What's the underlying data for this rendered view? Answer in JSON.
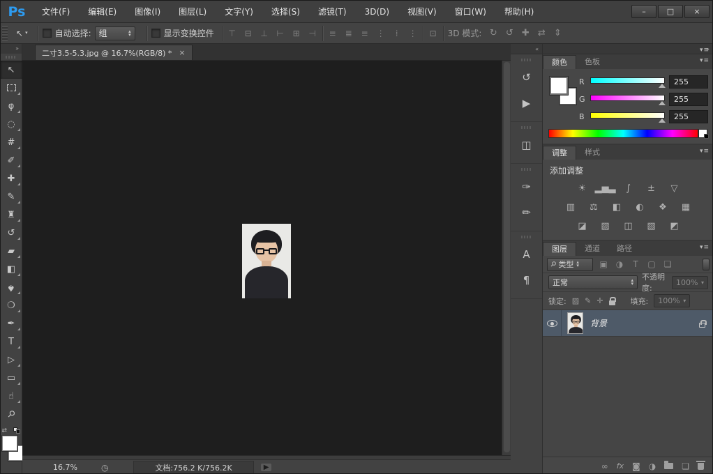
{
  "titlebar": {
    "logo": "Ps",
    "menus": [
      {
        "name": "menu-file",
        "label": "文件(F)"
      },
      {
        "name": "menu-edit",
        "label": "编辑(E)"
      },
      {
        "name": "menu-image",
        "label": "图像(I)"
      },
      {
        "name": "menu-layer",
        "label": "图层(L)"
      },
      {
        "name": "menu-type",
        "label": "文字(Y)"
      },
      {
        "name": "menu-select",
        "label": "选择(S)"
      },
      {
        "name": "menu-filter",
        "label": "滤镜(T)"
      },
      {
        "name": "menu-3d",
        "label": "3D(D)"
      },
      {
        "name": "menu-view",
        "label": "视图(V)"
      },
      {
        "name": "menu-window",
        "label": "窗口(W)"
      },
      {
        "name": "menu-help",
        "label": "帮助(H)"
      }
    ],
    "window_controls": {
      "minimize": "–",
      "maximize": "□",
      "close": "×"
    }
  },
  "options_bar": {
    "tool_glyph": "↖",
    "auto_select_label": "自动选择:",
    "auto_select_value": "组",
    "show_transform_label": "显示变换控件",
    "align_icons": [
      {
        "name": "align-top-edges-icon",
        "glyph": "⊤"
      },
      {
        "name": "align-vertical-centers-icon",
        "glyph": "⊟"
      },
      {
        "name": "align-bottom-edges-icon",
        "glyph": "⊥"
      },
      {
        "name": "align-left-edges-icon",
        "glyph": "⊢"
      },
      {
        "name": "align-horizontal-centers-icon",
        "glyph": "⊞"
      },
      {
        "name": "align-right-edges-icon",
        "glyph": "⊣"
      }
    ],
    "distribute_icons": [
      {
        "name": "distribute-top-edges-icon",
        "glyph": "≡"
      },
      {
        "name": "distribute-vertical-centers-icon",
        "glyph": "≣"
      },
      {
        "name": "distribute-bottom-edges-icon",
        "glyph": "≡"
      },
      {
        "name": "distribute-left-edges-icon",
        "glyph": "⋮"
      },
      {
        "name": "distribute-horizontal-centers-icon",
        "glyph": "⁞"
      },
      {
        "name": "distribute-right-edges-icon",
        "glyph": "⋮"
      }
    ],
    "auto_align": {
      "name": "auto-align-layers-icon",
      "glyph": "⊡"
    },
    "threed_label": "3D 模式:",
    "threed_icons": [
      {
        "name": "3d-rotate-icon",
        "glyph": "↻"
      },
      {
        "name": "3d-roll-icon",
        "glyph": "↺"
      },
      {
        "name": "3d-drag-icon",
        "glyph": "✚"
      },
      {
        "name": "3d-slide-icon",
        "glyph": "⇄"
      },
      {
        "name": "3d-scale-icon",
        "glyph": "⇕"
      }
    ]
  },
  "document_tab": {
    "title": "二寸3.5-5.3.jpg @ 16.7%(RGB/8) *",
    "close": "×"
  },
  "toolbar": {
    "collapse": "»",
    "tools": [
      {
        "name": "move-tool",
        "glyph": "↖",
        "cls": "selected"
      },
      {
        "name": "rectangular-marquee-tool",
        "glyph": "",
        "cls": "flyout marquee"
      },
      {
        "name": "lasso-tool",
        "glyph": "φ",
        "cls": "flyout"
      },
      {
        "name": "quick-selection-tool",
        "glyph": "◌",
        "cls": "flyout"
      },
      {
        "name": "crop-tool",
        "glyph": "#",
        "cls": "flyout"
      },
      {
        "name": "eyedropper-tool",
        "glyph": "✐",
        "cls": "flyout"
      },
      {
        "name": "spot-healing-brush-tool",
        "glyph": "✚",
        "cls": "flyout"
      },
      {
        "name": "brush-tool",
        "glyph": "✎",
        "cls": "flyout"
      },
      {
        "name": "clone-stamp-tool",
        "glyph": "♜",
        "cls": "flyout"
      },
      {
        "name": "history-brush-tool",
        "glyph": "↺",
        "cls": "flyout"
      },
      {
        "name": "eraser-tool",
        "glyph": "▰",
        "cls": "flyout"
      },
      {
        "name": "gradient-tool",
        "glyph": "◧",
        "cls": "flyout"
      },
      {
        "name": "blur-tool",
        "glyph": "♠",
        "cls": "flyout drop"
      },
      {
        "name": "dodge-tool",
        "glyph": "❍",
        "cls": "flyout"
      },
      {
        "name": "pen-tool",
        "glyph": "✒",
        "cls": "flyout"
      },
      {
        "name": "type-tool",
        "glyph": "T",
        "cls": "flyout"
      },
      {
        "name": "path-selection-tool",
        "glyph": "▷",
        "cls": "flyout"
      },
      {
        "name": "rectangle-tool",
        "glyph": "▭",
        "cls": "flyout"
      },
      {
        "name": "hand-tool",
        "glyph": "☝",
        "cls": "flyout"
      },
      {
        "name": "zoom-tool",
        "glyph": "⚲",
        "cls": "zoomrot"
      }
    ]
  },
  "dock": {
    "collapse": "«",
    "groups": [
      {
        "items": [
          {
            "name": "history-panel-icon",
            "glyph": "↺"
          },
          {
            "name": "actions-panel-icon",
            "glyph": "▶"
          }
        ]
      },
      {
        "items": [
          {
            "name": "properties-panel-icon",
            "glyph": "◫"
          }
        ]
      },
      {
        "items": [
          {
            "name": "brush-panel-icon",
            "glyph": "✑"
          },
          {
            "name": "brush-presets-panel-icon",
            "glyph": "✏"
          }
        ]
      },
      {
        "items": [
          {
            "name": "character-panel-icon",
            "glyph": "A"
          },
          {
            "name": "paragraph-panel-icon",
            "glyph": "¶"
          }
        ]
      }
    ]
  },
  "panels_header": {
    "collapse": "»"
  },
  "icons": {
    "dd_arrows": "▴\n▾",
    "panel_menu": "▾≡",
    "search": "⚲"
  },
  "color_panel": {
    "tabs": [
      {
        "name": "tab-color",
        "label": "颜色",
        "cls": "active"
      },
      {
        "name": "tab-swatches",
        "label": "色板",
        "cls": ""
      }
    ],
    "channels": [
      {
        "name": "red-channel",
        "label": "R",
        "value": "255",
        "track": "ch-r"
      },
      {
        "name": "green-channel",
        "label": "G",
        "value": "255",
        "track": "ch-g"
      },
      {
        "name": "blue-channel",
        "label": "B",
        "value": "255",
        "track": "ch-b"
      }
    ]
  },
  "adjustments_panel": {
    "tabs": [
      {
        "name": "tab-adjustments",
        "label": "调整",
        "cls": "active"
      },
      {
        "name": "tab-styles",
        "label": "样式",
        "cls": ""
      }
    ],
    "heading": "添加调整",
    "rows": [
      {
        "icons": [
          {
            "name": "brightness-contrast-icon",
            "glyph": "☀"
          },
          {
            "name": "levels-icon",
            "glyph": "▂▅▃"
          },
          {
            "name": "curves-icon",
            "glyph": "∫"
          },
          {
            "name": "exposure-icon",
            "glyph": "±"
          },
          {
            "name": "vibrance-icon",
            "glyph": "▽"
          }
        ]
      },
      {
        "icons": [
          {
            "name": "hue-saturation-icon",
            "glyph": "▥"
          },
          {
            "name": "color-balance-icon",
            "glyph": "⚖"
          },
          {
            "name": "black-white-icon",
            "glyph": "◧"
          },
          {
            "name": "photo-filter-icon",
            "glyph": "◐"
          },
          {
            "name": "channel-mixer-icon",
            "glyph": "❖"
          },
          {
            "name": "color-lookup-icon",
            "glyph": "▦"
          }
        ]
      },
      {
        "icons": [
          {
            "name": "invert-icon",
            "glyph": "◪"
          },
          {
            "name": "posterize-icon",
            "glyph": "▨"
          },
          {
            "name": "threshold-icon",
            "glyph": "◫"
          },
          {
            "name": "gradient-map-icon",
            "glyph": "▧"
          },
          {
            "name": "selective-color-icon",
            "glyph": "◩"
          }
        ]
      }
    ]
  },
  "layers_panel": {
    "tabs": [
      {
        "name": "tab-layers",
        "label": "图层",
        "cls": "active"
      },
      {
        "name": "tab-channels",
        "label": "通道",
        "cls": ""
      },
      {
        "name": "tab-paths",
        "label": "路径",
        "cls": ""
      }
    ],
    "filter": {
      "label": "类型",
      "icons": [
        {
          "name": "filter-pixel-layers-icon",
          "glyph": "▣"
        },
        {
          "name": "filter-adjustment-layers-icon",
          "glyph": "◑"
        },
        {
          "name": "filter-type-layers-icon",
          "glyph": "T"
        },
        {
          "name": "filter-shape-layers-icon",
          "glyph": "▢"
        },
        {
          "name": "filter-smart-objects-icon",
          "glyph": "❏"
        }
      ]
    },
    "blend": {
      "value": "正常",
      "opacity_label": "不透明度:",
      "opacity_value": "100%",
      "arrow": "▾"
    },
    "lock": {
      "label": "锁定:",
      "fill_label": "填充:",
      "fill_value": "100%",
      "arrow": "▾",
      "icons": [
        {
          "name": "lock-transparent-pixels-icon",
          "glyph": "▨"
        },
        {
          "name": "lock-image-pixels-icon",
          "glyph": "✎"
        },
        {
          "name": "lock-position-icon",
          "glyph": "✛"
        }
      ]
    },
    "layers": [
      {
        "name": "背景"
      }
    ],
    "bottom": {
      "link": "∞",
      "fx": "fx",
      "mask": "◙",
      "adjustment": "◑",
      "new_layer": "❏"
    }
  },
  "status_bar": {
    "zoom": "16.7%",
    "icon": "◷",
    "doc_info": "文档:756.2 K/756.2K",
    "expand": "▶"
  }
}
